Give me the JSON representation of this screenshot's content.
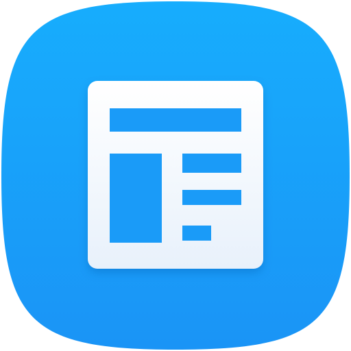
{
  "app_icon": {
    "icon": "news-reader-icon",
    "colors": {
      "tile_gradient_top": "#17adfd",
      "tile_gradient_bottom": "#1a94f6",
      "document_fill_top": "#ffffff",
      "document_fill_bottom": "#e8f1fb",
      "document_blocks": "#1a9bf8"
    }
  }
}
